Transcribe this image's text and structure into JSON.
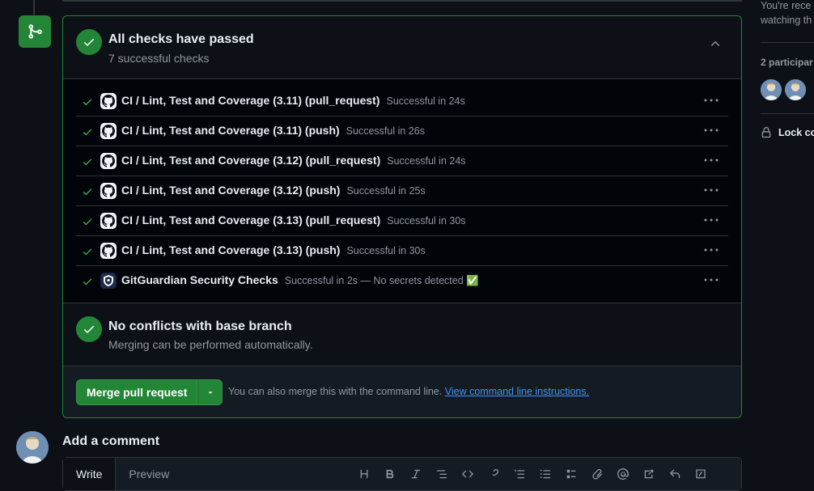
{
  "checks_header": {
    "title": "All checks have passed",
    "subtitle": "7 successful checks"
  },
  "checks": [
    {
      "name": "CI / Lint, Test and Coverage (3.11) (pull_request)",
      "status": "Successful in 24s",
      "app": "github-icon"
    },
    {
      "name": "CI / Lint, Test and Coverage (3.11) (push)",
      "status": "Successful in 26s",
      "app": "github-icon"
    },
    {
      "name": "CI / Lint, Test and Coverage (3.12) (pull_request)",
      "status": "Successful in 24s",
      "app": "github-icon"
    },
    {
      "name": "CI / Lint, Test and Coverage (3.12) (push)",
      "status": "Successful in 25s",
      "app": "github-icon"
    },
    {
      "name": "CI / Lint, Test and Coverage (3.13) (pull_request)",
      "status": "Successful in 30s",
      "app": "github-icon"
    },
    {
      "name": "CI / Lint, Test and Coverage (3.13) (push)",
      "status": "Successful in 30s",
      "app": "github-icon"
    },
    {
      "name": "GitGuardian Security Checks",
      "status": "Successful in 2s — No secrets detected ✅",
      "app": "gitguardian-icon"
    }
  ],
  "conflicts": {
    "title": "No conflicts with base branch",
    "subtitle": "Merging can be performed automatically."
  },
  "merge": {
    "button_label": "Merge pull request",
    "hint": "You can also merge this with the command line.",
    "link": "View command line instructions."
  },
  "comment": {
    "title": "Add a comment",
    "tabs": [
      "Write",
      "Preview"
    ]
  },
  "sidebar": {
    "notification_line1": "You're rece",
    "notification_line2": "watching th",
    "participants_title": "2 participar",
    "lock_label": "Lock co"
  },
  "colors": {
    "success": "#238636",
    "check_green": "#3fb950",
    "link": "#4493f8",
    "muted": "#9198a1",
    "border": "#30363d"
  }
}
